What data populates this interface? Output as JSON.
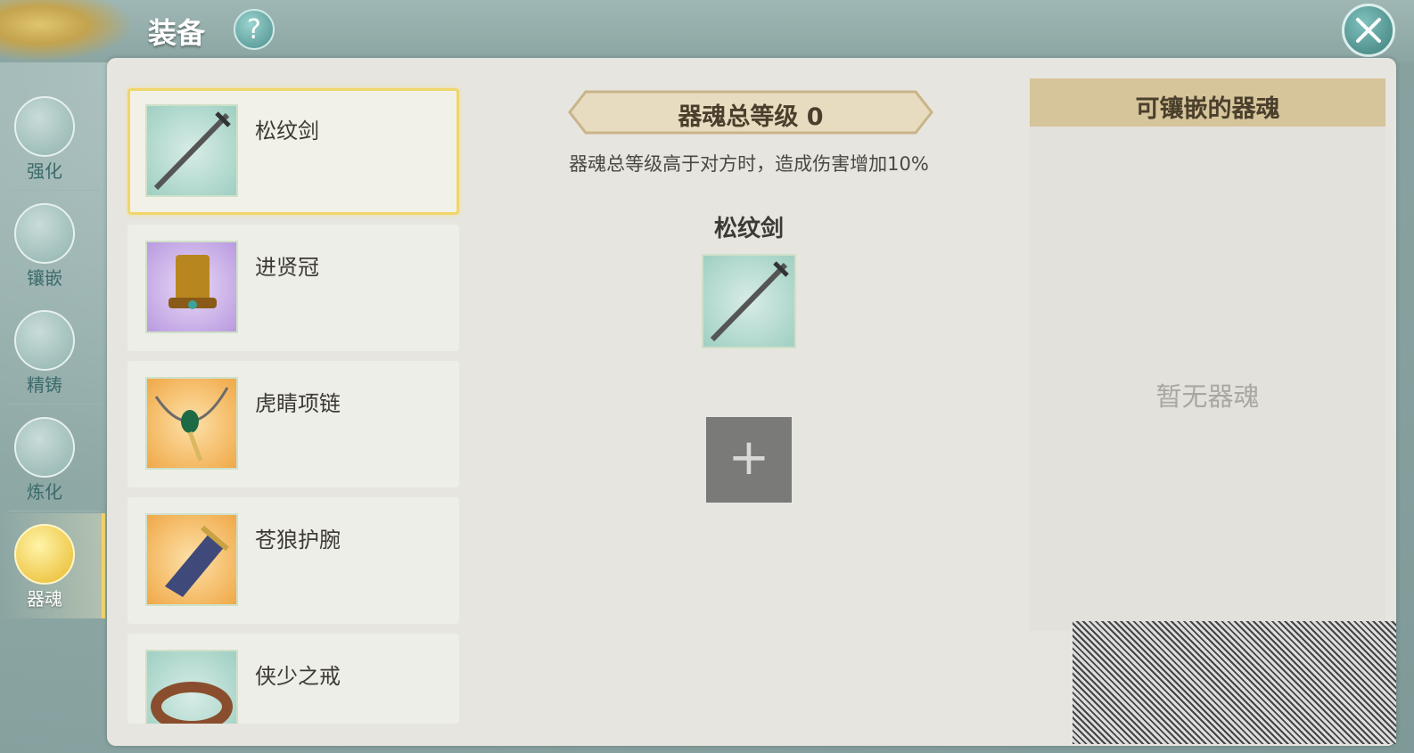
{
  "header": {
    "title": "装备",
    "help_icon": "?"
  },
  "sidebar": {
    "items": [
      {
        "label": "强化",
        "icon": "hammer-icon",
        "active": false
      },
      {
        "label": "镶嵌",
        "icon": "gem-icon",
        "active": false
      },
      {
        "label": "精铸",
        "icon": "anvil-icon",
        "active": false
      },
      {
        "label": "炼化",
        "icon": "swirl-icon",
        "active": false
      },
      {
        "label": "器魂",
        "icon": "soul-icon",
        "active": true
      }
    ]
  },
  "equipment": {
    "items": [
      {
        "name": "松纹剑",
        "icon": "sword-icon",
        "bg": "teal",
        "selected": true
      },
      {
        "name": "进贤冠",
        "icon": "crown-hat-icon",
        "bg": "purple",
        "selected": false
      },
      {
        "name": "虎睛项链",
        "icon": "necklace-icon",
        "bg": "orange",
        "selected": false
      },
      {
        "name": "苍狼护腕",
        "icon": "bracer-icon",
        "bg": "orange",
        "selected": false
      },
      {
        "name": "侠少之戒",
        "icon": "ring-icon",
        "bg": "teal",
        "selected": false
      }
    ]
  },
  "soul": {
    "total_level_label": "器魂总等级 0",
    "description": "器魂总等级高于对方时，造成伤害增加10%",
    "selected_name": "松纹剑",
    "add_symbol": "+"
  },
  "right_panel": {
    "title": "可镶嵌的器魂",
    "empty_text": "暂无器魂"
  },
  "colors": {
    "accent_gold": "#f0d66a",
    "header_tan": "#d6c49a",
    "bg_teal": "#8ea8a6"
  }
}
